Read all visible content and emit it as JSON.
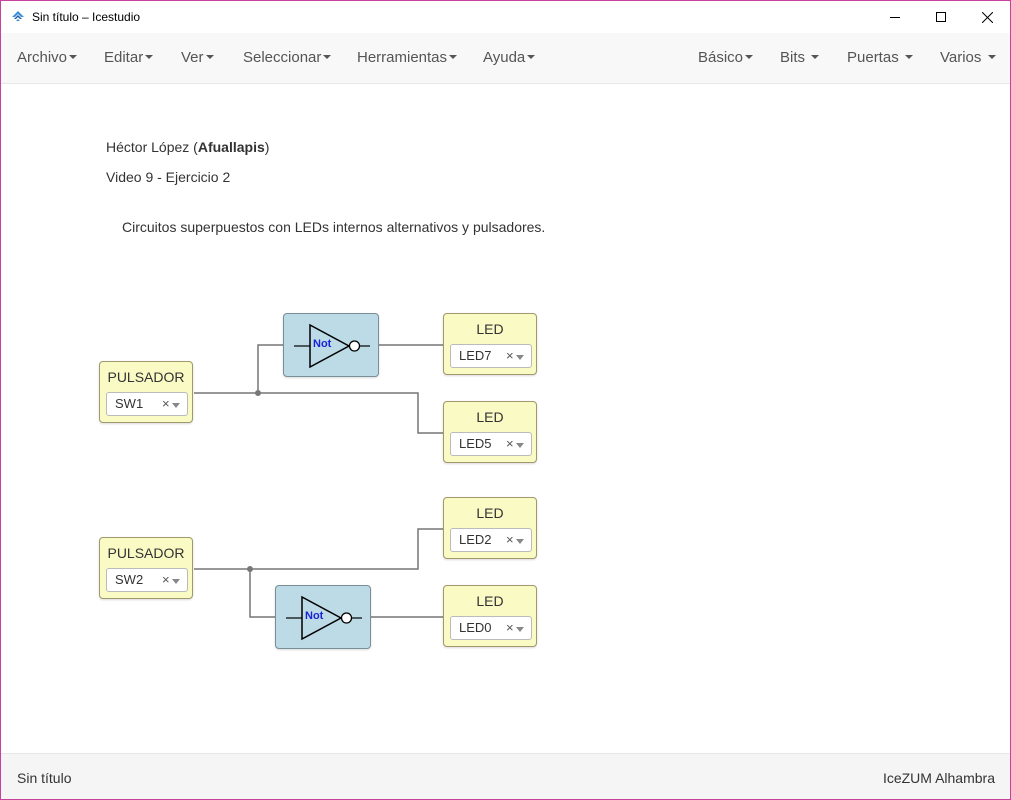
{
  "window": {
    "title": "Sin título – Icestudio"
  },
  "menu_left": [
    {
      "label": "Archivo"
    },
    {
      "label": "Editar"
    },
    {
      "label": "Ver"
    },
    {
      "label": "Seleccionar"
    },
    {
      "label": "Herramientas"
    },
    {
      "label": "Ayuda"
    }
  ],
  "menu_right": [
    {
      "label": "Básico"
    },
    {
      "label": "Bits"
    },
    {
      "label": "Puertas"
    },
    {
      "label": "Varios"
    }
  ],
  "notes": {
    "author_name": "Héctor López",
    "author_open": " (",
    "author_nick": "Afuallapis",
    "author_close": ")",
    "subtitle": "Video 9 - Ejercicio 2",
    "description": "Circuitos superpuestos con LEDs internos alternativos y pulsadores."
  },
  "blocks": {
    "pulsador1": {
      "title": "PULSADOR",
      "value": "SW1",
      "clear": "×"
    },
    "pulsador2": {
      "title": "PULSADOR",
      "value": "SW2",
      "clear": "×"
    },
    "led7": {
      "title": "LED",
      "value": "LED7",
      "clear": "×"
    },
    "led5": {
      "title": "LED",
      "value": "LED5",
      "clear": "×"
    },
    "led2": {
      "title": "LED",
      "value": "LED2",
      "clear": "×"
    },
    "led0": {
      "title": "LED",
      "value": "LED0",
      "clear": "×"
    },
    "not1": {
      "label": "Not"
    },
    "not2": {
      "label": "Not"
    }
  },
  "footer": {
    "left": "Sin título",
    "right": "IceZUM Alhambra"
  },
  "colors": {
    "io_block_bg": "#fafac5",
    "not_block_bg": "#bcdbe6",
    "not_label": "#1a22d6",
    "window_border": "#c8419a",
    "wire": "#777777"
  }
}
